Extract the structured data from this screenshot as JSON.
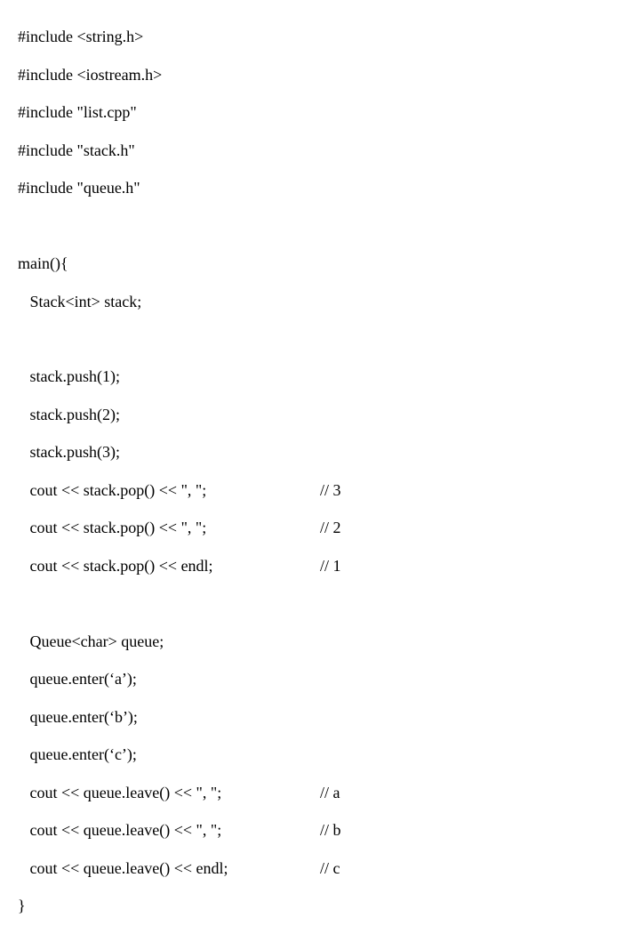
{
  "lines": {
    "inc1": "#include <string.h>",
    "inc2": "#include <iostream.h>",
    "inc3": "#include \"list.cpp\"",
    "inc4": "#include \"stack.h\"",
    "inc5": "#include \"queue.h\"",
    "blank": " ",
    "mainopen": "main(){",
    "stackdecl": "   Stack<int> stack;",
    "push1": "   stack.push(1);",
    "push2": "   stack.push(2);",
    "push3": "   stack.push(3);",
    "popline1_left": "   cout << stack.pop() << \", \";",
    "popline1_right": "// 3",
    "popline2_left": "   cout << stack.pop() << \", \";",
    "popline2_right": "// 2",
    "popline3_left": "   cout << stack.pop() << endl;",
    "popline3_right": "// 1",
    "queuedecl": "   Queue<char> queue;",
    "enter1": "   queue.enter(‘a’);",
    "enter2": "   queue.enter(‘b’);",
    "enter3": "   queue.enter(‘c’);",
    "leave1_left": "   cout << queue.leave() << \", \";",
    "leave1_right": "// a",
    "leave2_left": "   cout << queue.leave() << \", \";",
    "leave2_right": "// b",
    "leave3_left": "   cout << queue.leave() << endl;",
    "leave3_right": "// c",
    "close": "}"
  }
}
